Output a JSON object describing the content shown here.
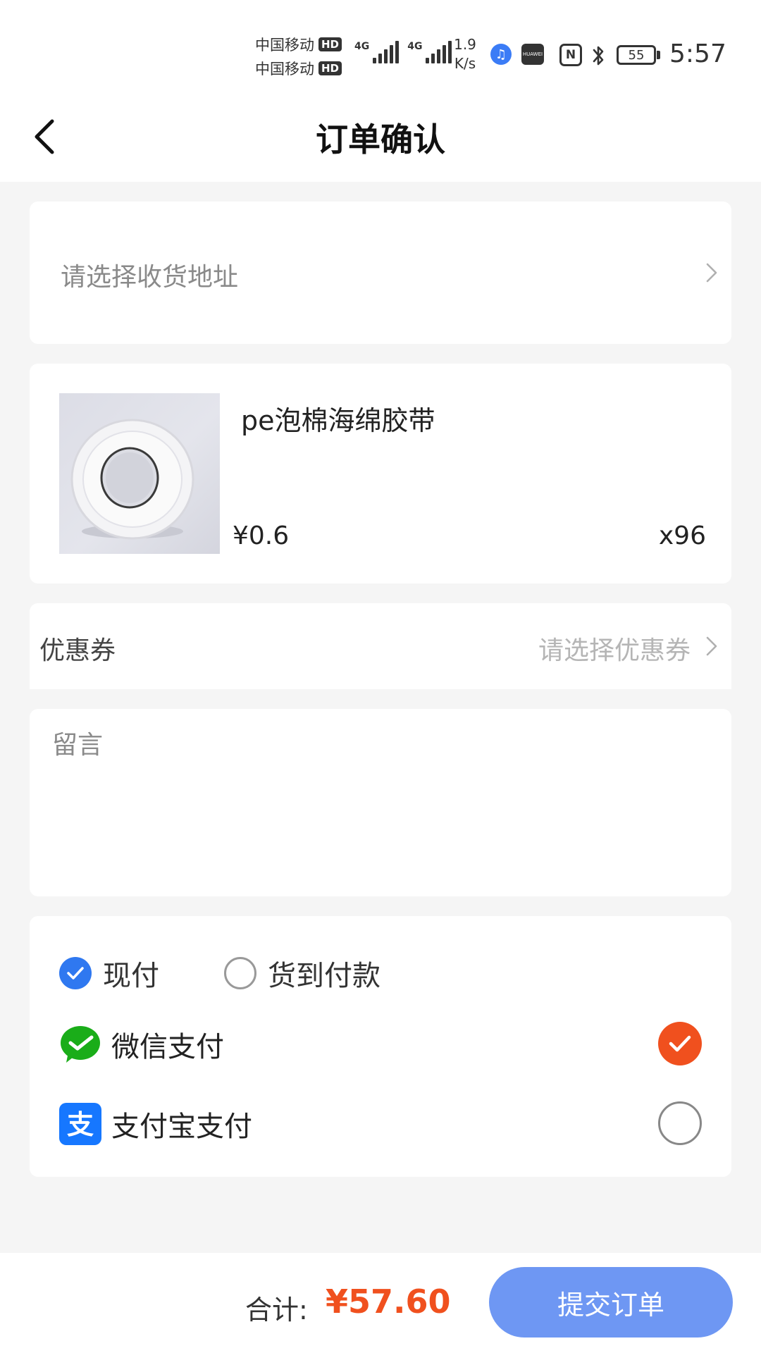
{
  "status_bar": {
    "carrier_1": "中国移动",
    "carrier_2": "中国移动",
    "hd_badge": "HD",
    "network_type_1": "4G",
    "network_type_2": "4G",
    "net_speed_value": "1.9",
    "net_speed_unit": "K/s",
    "huawei_label": "HUAWEI",
    "nfc_label": "N",
    "battery_level": "55",
    "time": "5:57"
  },
  "header": {
    "title": "订单确认"
  },
  "address": {
    "placeholder": "请选择收货地址"
  },
  "product": {
    "name": "pe泡棉海绵胶带",
    "price": "¥0.6",
    "quantity": "x96"
  },
  "coupon": {
    "label": "优惠券",
    "placeholder": "请选择优惠券"
  },
  "message": {
    "placeholder": "留言",
    "value": ""
  },
  "payment": {
    "timing_options": [
      {
        "label": "现付",
        "selected": true
      },
      {
        "label": "货到付款",
        "selected": false
      }
    ],
    "methods": [
      {
        "label": "微信支付",
        "icon": "wechat-pay-icon",
        "selected": true
      },
      {
        "label": "支付宝支付",
        "icon": "alipay-icon",
        "selected": false
      }
    ]
  },
  "footer": {
    "total_label": "合计:",
    "total_amount": "¥57.60",
    "submit_label": "提交订单"
  },
  "colors": {
    "accent_orange": "#f0501e",
    "primary_blue": "#2f78f0",
    "submit_blue": "#6e97f3",
    "wechat_green": "#1aad19",
    "alipay_blue": "#1677ff"
  }
}
